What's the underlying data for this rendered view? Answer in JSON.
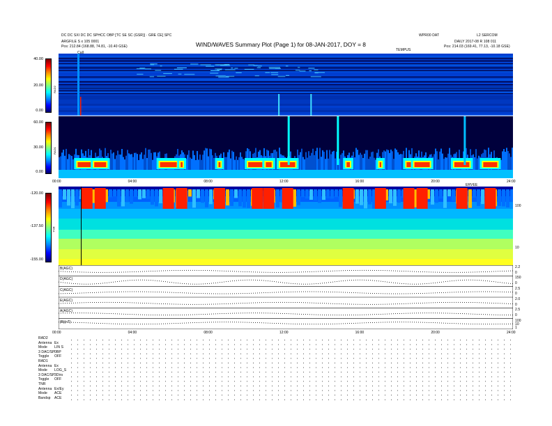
{
  "header": {
    "title": "WIND/WAVES Summary Plot (Page 1) for 08-JAN-2017, DOY = 8",
    "left_line1": "DC DC SXI DC DC SPHCC OBP [TC SE SC (GSR)] · GRE CE[ SPC",
    "left_line2": "ARGFILE S x 105 0001",
    "left_line3": "Pos:   212.84 (168.88, 74.81, -10.40 GSE)",
    "center_small": "TEMPUS",
    "right_top_left": "WPR00 DAT",
    "right_top_right": "L2 SERCOM",
    "right_line2": "DAILY 2017-08 R 108 011",
    "right_line3": "Pos:   214.03 (169.41, 77.13, -10.18 GSE)"
  },
  "panels": {
    "rad2": {
      "name": "RAD2",
      "ticks": [
        "40.00",
        "20.00",
        "0.00"
      ]
    },
    "rad1": {
      "name": "RAD1",
      "ticks": [
        "60.00",
        "30.00",
        "0.00"
      ]
    },
    "tnr": {
      "name": "TNR",
      "ticks": [
        "-120.00",
        "-137.50",
        "-155.00"
      ],
      "right_ticks": [
        "100",
        "10"
      ]
    }
  },
  "time_axis": {
    "top": [
      "00:00",
      "04:00",
      "08:00",
      "12:00",
      "16:00",
      "20:00",
      "24:00"
    ],
    "bottom": [
      "00:00",
      "04:00",
      "08:00",
      "12:00",
      "16:00",
      "20:00",
      "24:00"
    ],
    "near_top_left": "CaII",
    "near_tnr_right": "ERVEE"
  },
  "hk_rows": [
    {
      "label": "B(AGC)",
      "right_ticks": [
        "2.2",
        "0"
      ]
    },
    {
      "label": "D(AGC)",
      "right_ticks": [
        "150",
        "0"
      ]
    },
    {
      "label": "C(AGC)",
      "right_ticks": [
        "2.5",
        "0"
      ]
    },
    {
      "label": "E(AGC)",
      "right_ticks": [
        "2.0",
        "0"
      ]
    },
    {
      "label": "A(AGC)",
      "right_ticks": [
        "2.5",
        "0"
      ]
    },
    {
      "label": "|B|(nT)",
      "right_ticks": [
        "100",
        "10",
        "1"
      ]
    }
  ],
  "footer_rows": [
    {
      "label": "RAD2",
      "value": ""
    },
    {
      "label": "Antenna",
      "value": "Ex"
    },
    {
      "label": "Mode",
      "value": "LIN S"
    },
    {
      "label": "3 DAC/SP",
      "value": "0BP"
    },
    {
      "label": "Toggle",
      "value": "OFF"
    },
    {
      "label": "RAD1",
      "value": ""
    },
    {
      "label": "Antenna",
      "value": "Ex"
    },
    {
      "label": "Mode",
      "value": "LOG_S"
    },
    {
      "label": "3 DAC/SP",
      "value": "3Dirs"
    },
    {
      "label": "Toggle",
      "value": "OFF"
    },
    {
      "label": "TNR",
      "value": ""
    },
    {
      "label": "Antenna",
      "value": "Ex/Ey"
    },
    {
      "label": "Mode",
      "value": "ACE"
    },
    {
      "label": "Bandsp",
      "value": "ACE"
    }
  ],
  "chart_data": {
    "type": "heatmap",
    "title": "WIND/WAVES Summary Plot (Page 1) for 08-JAN-2017, DOY = 8",
    "x_range_hours": [
      0,
      24
    ],
    "x_ticks": [
      "00:00",
      "04:00",
      "08:00",
      "12:00",
      "16:00",
      "20:00",
      "24:00"
    ],
    "panels": [
      {
        "name": "RAD2",
        "y_ticks": [
          "40.00",
          "20.00",
          "0.00"
        ]
      },
      {
        "name": "RAD1",
        "y_ticks": [
          "60.00",
          "30.00",
          "0.00"
        ]
      },
      {
        "name": "TNR",
        "y_ticks": [
          "-120.00",
          "-137.50",
          "-155.00"
        ]
      }
    ],
    "colormap": [
      "#00006a",
      "#0000ff",
      "#0088ff",
      "#00ffff",
      "#7fff7f",
      "#ffff00",
      "#ff8a00",
      "#ff0000",
      "#7a0000"
    ],
    "intense_emission_hours": [
      1.5,
      2.2,
      5.8,
      6.5,
      8.5,
      10.5,
      11.1,
      12.1,
      15.3,
      17.0,
      18.5,
      19.2,
      21.3,
      22.8
    ]
  }
}
